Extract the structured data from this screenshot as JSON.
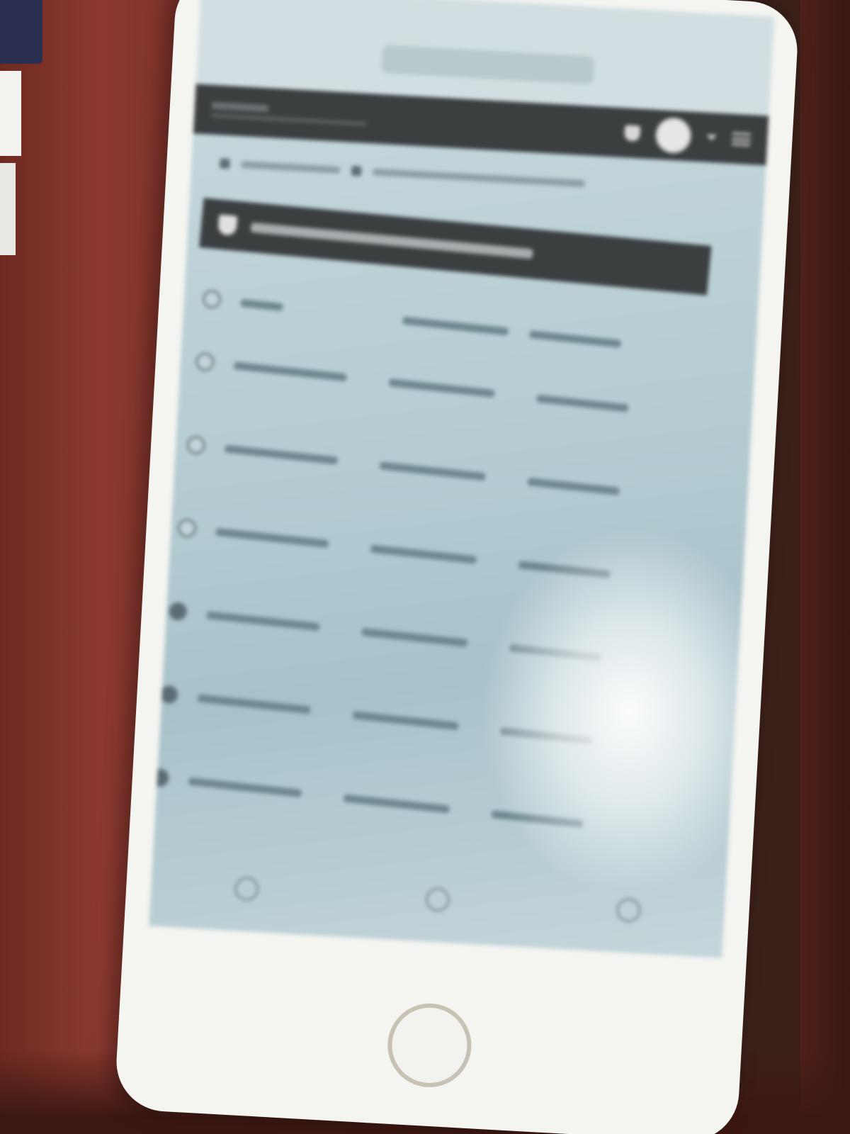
{
  "header": {
    "brand": "",
    "notifications": "",
    "user_menu": ""
  },
  "breadcrumb": {
    "items": [
      "",
      ""
    ]
  },
  "panel": {
    "title": ""
  },
  "list": {
    "headers": [
      "",
      "",
      ""
    ],
    "rows": [
      {
        "name": "",
        "code": "",
        "date": "",
        "selected": false
      },
      {
        "name": "",
        "code": "",
        "date": "",
        "selected": false
      },
      {
        "name": "",
        "code": "",
        "date": "",
        "selected": false
      },
      {
        "name": "",
        "code": "",
        "date": "",
        "selected": true
      },
      {
        "name": "",
        "code": "",
        "date": "",
        "selected": true
      },
      {
        "name": "",
        "code": "",
        "date": "",
        "selected": true
      }
    ]
  },
  "colors": {
    "header_bg": "#3b3f40",
    "screen_bg": "#b6cdd3",
    "case": "#8c3a30"
  }
}
